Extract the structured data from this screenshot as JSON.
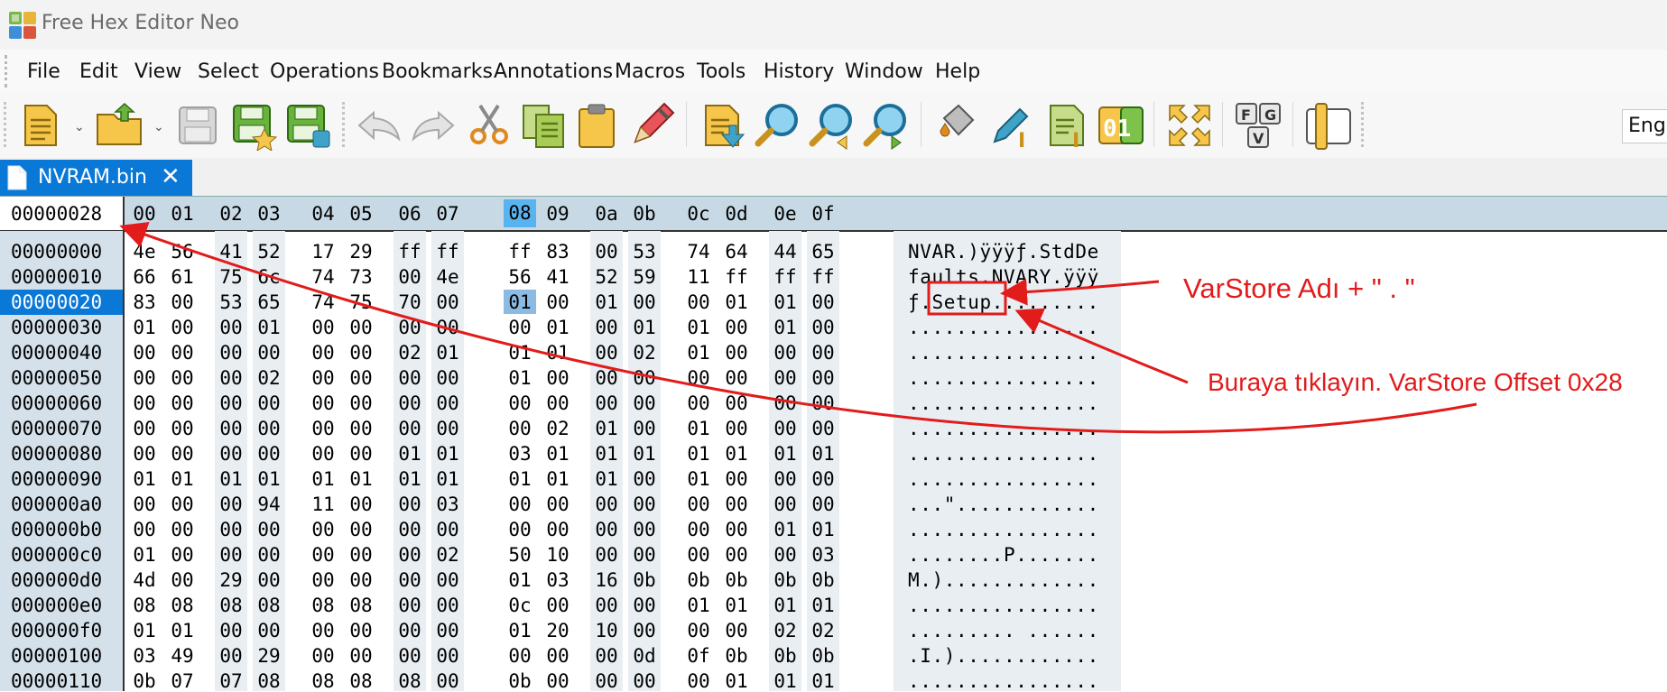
{
  "window": {
    "title": "Free Hex Editor Neo"
  },
  "menu": [
    "File",
    "Edit",
    "View",
    "Select",
    "Operations",
    "Bookmarks",
    "Annotations",
    "Macros",
    "Tools",
    "History",
    "Window",
    "Help"
  ],
  "toolbar": {
    "icons": [
      "new-file-icon",
      "open-folder-icon",
      "save-icon",
      "save-as-icon",
      "save-copy-icon",
      "undo-icon",
      "redo-icon",
      "cut-icon",
      "copy-icon",
      "paste-icon",
      "pencil-icon",
      "import-icon",
      "find-icon",
      "find-previous-icon",
      "find-next-icon",
      "fill-icon",
      "edit-column-icon",
      "insert-column-icon",
      "data-01-icon",
      "expand-icon",
      "keyboard-fgv-icon",
      "split-view-icon"
    ],
    "language": "Engl",
    "data_label": "01",
    "fgv_keys": [
      "F",
      "G",
      "V"
    ]
  },
  "tab": {
    "label": "NVRAM.bin"
  },
  "editor": {
    "current_offset": "00000028",
    "columns": [
      "00",
      "01",
      "02",
      "03",
      "04",
      "05",
      "06",
      "07",
      "08",
      "09",
      "0a",
      "0b",
      "0c",
      "0d",
      "0e",
      "0f"
    ],
    "selected_column": 8,
    "selected_row": 2,
    "rows": [
      {
        "addr": "00000000",
        "bytes": [
          "4e",
          "56",
          "41",
          "52",
          "17",
          "29",
          "ff",
          "ff",
          "ff",
          "83",
          "00",
          "53",
          "74",
          "64",
          "44",
          "65"
        ],
        "ascii": "NVAR.)ÿÿÿƒ.StdDe"
      },
      {
        "addr": "00000010",
        "bytes": [
          "66",
          "61",
          "75",
          "6c",
          "74",
          "73",
          "00",
          "4e",
          "56",
          "41",
          "52",
          "59",
          "11",
          "ff",
          "ff",
          "ff"
        ],
        "ascii": "faults.NVARY.ÿÿÿ"
      },
      {
        "addr": "00000020",
        "bytes": [
          "83",
          "00",
          "53",
          "65",
          "74",
          "75",
          "70",
          "00",
          "01",
          "00",
          "01",
          "00",
          "00",
          "01",
          "01",
          "00"
        ],
        "ascii": "ƒ.Setup........."
      },
      {
        "addr": "00000030",
        "bytes": [
          "01",
          "00",
          "00",
          "01",
          "00",
          "00",
          "00",
          "00",
          "00",
          "01",
          "00",
          "01",
          "01",
          "00",
          "01",
          "00"
        ],
        "ascii": "................"
      },
      {
        "addr": "00000040",
        "bytes": [
          "00",
          "00",
          "00",
          "00",
          "00",
          "00",
          "02",
          "01",
          "01",
          "01",
          "00",
          "02",
          "01",
          "00",
          "00",
          "00"
        ],
        "ascii": "................"
      },
      {
        "addr": "00000050",
        "bytes": [
          "00",
          "00",
          "00",
          "02",
          "00",
          "00",
          "00",
          "00",
          "01",
          "00",
          "00",
          "00",
          "00",
          "00",
          "00",
          "00"
        ],
        "ascii": "................"
      },
      {
        "addr": "00000060",
        "bytes": [
          "00",
          "00",
          "00",
          "00",
          "00",
          "00",
          "00",
          "00",
          "00",
          "00",
          "00",
          "00",
          "00",
          "00",
          "00",
          "00"
        ],
        "ascii": "................"
      },
      {
        "addr": "00000070",
        "bytes": [
          "00",
          "00",
          "00",
          "00",
          "00",
          "00",
          "00",
          "00",
          "00",
          "02",
          "01",
          "00",
          "01",
          "00",
          "00",
          "00"
        ],
        "ascii": "................"
      },
      {
        "addr": "00000080",
        "bytes": [
          "00",
          "00",
          "00",
          "00",
          "00",
          "00",
          "01",
          "01",
          "03",
          "01",
          "01",
          "01",
          "01",
          "01",
          "01",
          "01"
        ],
        "ascii": "................"
      },
      {
        "addr": "00000090",
        "bytes": [
          "01",
          "01",
          "01",
          "01",
          "01",
          "01",
          "01",
          "01",
          "01",
          "01",
          "01",
          "00",
          "01",
          "00",
          "00",
          "00"
        ],
        "ascii": "................"
      },
      {
        "addr": "000000a0",
        "bytes": [
          "00",
          "00",
          "00",
          "94",
          "11",
          "00",
          "00",
          "03",
          "00",
          "00",
          "00",
          "00",
          "00",
          "00",
          "00",
          "00"
        ],
        "ascii": "...\"............"
      },
      {
        "addr": "000000b0",
        "bytes": [
          "00",
          "00",
          "00",
          "00",
          "00",
          "00",
          "00",
          "00",
          "00",
          "00",
          "00",
          "00",
          "00",
          "00",
          "01",
          "01"
        ],
        "ascii": "................"
      },
      {
        "addr": "000000c0",
        "bytes": [
          "01",
          "00",
          "00",
          "00",
          "00",
          "00",
          "00",
          "02",
          "50",
          "10",
          "00",
          "00",
          "00",
          "00",
          "00",
          "03"
        ],
        "ascii": "........P......."
      },
      {
        "addr": "000000d0",
        "bytes": [
          "4d",
          "00",
          "29",
          "00",
          "00",
          "00",
          "00",
          "00",
          "01",
          "03",
          "16",
          "0b",
          "0b",
          "0b",
          "0b",
          "0b"
        ],
        "ascii": "M.)............."
      },
      {
        "addr": "000000e0",
        "bytes": [
          "08",
          "08",
          "08",
          "08",
          "08",
          "08",
          "00",
          "00",
          "0c",
          "00",
          "00",
          "00",
          "01",
          "01",
          "01",
          "01"
        ],
        "ascii": "................"
      },
      {
        "addr": "000000f0",
        "bytes": [
          "01",
          "01",
          "00",
          "00",
          "00",
          "00",
          "00",
          "00",
          "01",
          "20",
          "10",
          "00",
          "00",
          "00",
          "02",
          "02"
        ],
        "ascii": "......... ......"
      },
      {
        "addr": "00000100",
        "bytes": [
          "03",
          "49",
          "00",
          "29",
          "00",
          "00",
          "00",
          "00",
          "00",
          "00",
          "00",
          "0d",
          "0f",
          "0b",
          "0b",
          "0b"
        ],
        "ascii": ".I.)............"
      },
      {
        "addr": "00000110",
        "bytes": [
          "0b",
          "07",
          "07",
          "08",
          "08",
          "08",
          "08",
          "00",
          "0b",
          "00",
          "00",
          "00",
          "00",
          "01",
          "01",
          "01"
        ],
        "ascii": "................"
      }
    ]
  },
  "annotations": {
    "varstore_name": "VarStore Adı + \" . \"",
    "click_here": "Buraya tıklayın. VarStore Offset 0x28",
    "color": "#e21b1b"
  },
  "colors": {
    "accent": "#0a78d7",
    "header_bg": "#c8d9e6",
    "selection": "#8bbbe3"
  }
}
